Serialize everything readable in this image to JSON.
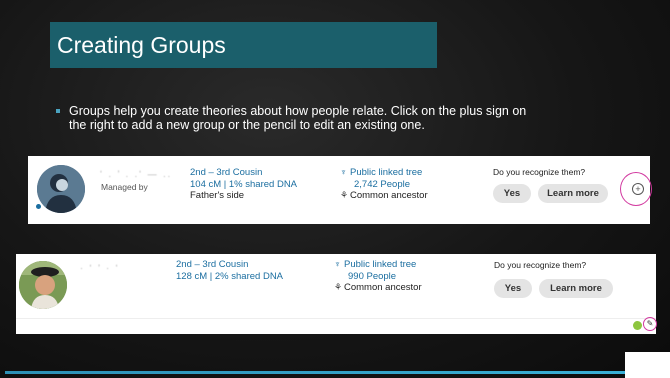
{
  "slide": {
    "title": "Creating Groups",
    "bullet": "Groups help you create theories about how people relate.  Click on the plus sign on the right to add a new group or the pencil to edit an existing one."
  },
  "card1": {
    "name_obscured": "‘ . ’ . .‘ — ..",
    "managed_by": "Managed by",
    "relationship": "2nd – 3rd Cousin",
    "shared_dna": "104 cM | 1% shared DNA",
    "side": "Father's side",
    "tree_label": "Public linked tree",
    "tree_people": "2,742 People",
    "common_ancestor": "Common ancestor",
    "recognize": "Do you recognize them?",
    "yes": "Yes",
    "learn_more": "Learn more",
    "add_icon": "plus-circle-icon"
  },
  "card2": {
    "name_obscured": "· ‘ ’ · ‘",
    "relationship": "2nd – 3rd Cousin",
    "shared_dna": "128 cM | 2% shared DNA",
    "tree_label": "Public linked tree",
    "tree_people": "990 People",
    "common_ancestor": "Common ancestor",
    "recognize": "Do you recognize them?",
    "yes": "Yes",
    "learn_more": "Learn more",
    "edit_icon": "pencil-icon"
  },
  "colors": {
    "title_bg": "#1b5f6b",
    "link_blue": "#1b6ea0",
    "annotation": "#d23aa0",
    "group_dot": "#8dc63f"
  }
}
